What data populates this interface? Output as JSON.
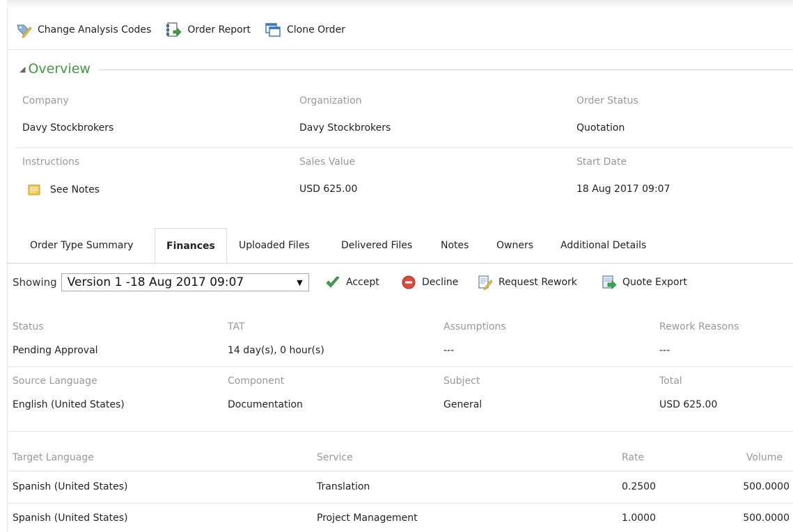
{
  "toolbar": {
    "change_analysis": "Change Analysis Codes",
    "order_report": "Order Report",
    "clone_order": "Clone Order"
  },
  "overview": {
    "title": "Overview",
    "company_label": "Company",
    "company_value": "Davy Stockbrokers",
    "organization_label": "Organization",
    "organization_value": "Davy Stockbrokers",
    "order_status_label": "Order Status",
    "order_status_value": "Quotation",
    "instructions_label": "Instructions",
    "instructions_value": "See Notes",
    "sales_value_label": "Sales Value",
    "sales_value_value": "USD 625.00",
    "start_date_label": "Start Date",
    "start_date_value": "18 Aug 2017 09:07"
  },
  "tabs": [
    {
      "label": "Order Type Summary"
    },
    {
      "label": "Finances"
    },
    {
      "label": "Uploaded Files"
    },
    {
      "label": "Delivered Files"
    },
    {
      "label": "Notes"
    },
    {
      "label": "Owners"
    },
    {
      "label": "Additional Details"
    }
  ],
  "finances": {
    "showing_label": "Showing",
    "version_selected": "Version 1 -18 Aug 2017 09:07",
    "accept": "Accept",
    "decline": "Decline",
    "request_rework": "Request Rework",
    "quote_export": "Quote Export",
    "status_label": "Status",
    "status_value": "Pending Approval",
    "tat_label": "TAT",
    "tat_value": "14 day(s), 0 hour(s)",
    "assumptions_label": "Assumptions",
    "assumptions_value": "---",
    "rework_reasons_label": "Rework Reasons",
    "rework_reasons_value": "---",
    "source_language_label": "Source Language",
    "source_language_value": "English (United States)",
    "component_label": "Component",
    "component_value": "Documentation",
    "subject_label": "Subject",
    "subject_value": "General",
    "total_label": "Total",
    "total_value": "USD 625.00"
  },
  "table": {
    "headers": [
      "Target Language",
      "Service",
      "Rate",
      "Volume"
    ],
    "rows": [
      [
        "Spanish (United States)",
        "Translation",
        "0.2500",
        "500.0000"
      ],
      [
        "Spanish (United States)",
        "Project Management",
        "1.0000",
        "500.0000"
      ]
    ]
  },
  "colors": {
    "overview_title": "#3d9a3d",
    "label_grey": "#999999",
    "accept_green": "#3aa84a",
    "decline_red": "#e0493a"
  }
}
